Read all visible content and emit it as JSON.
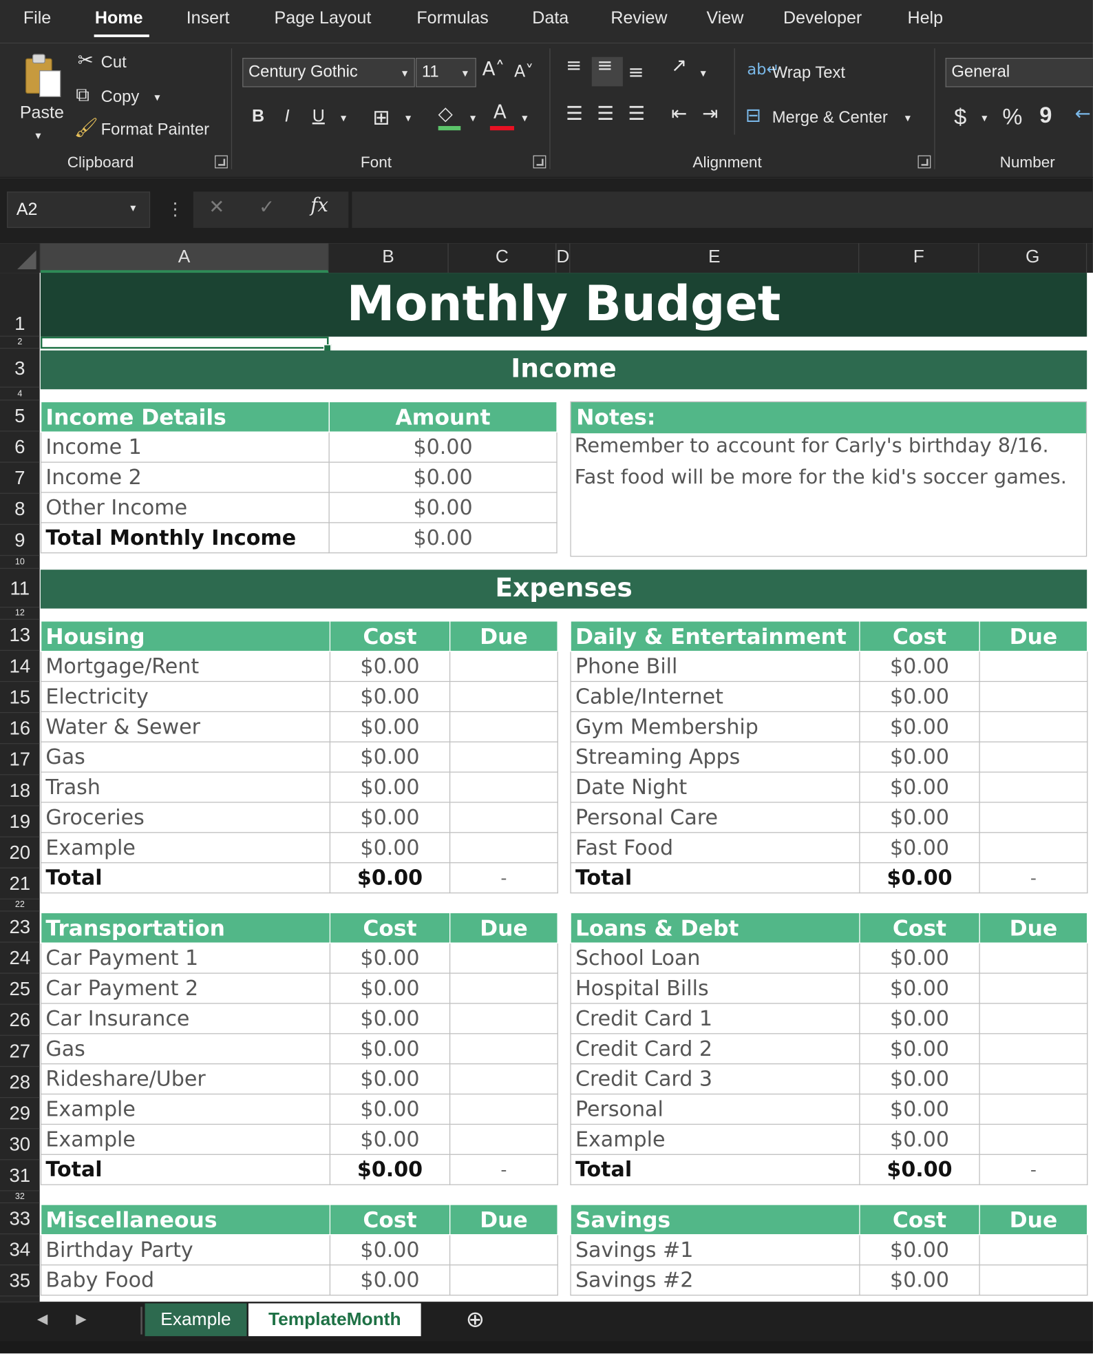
{
  "menu": [
    "File",
    "Home",
    "Insert",
    "Page Layout",
    "Formulas",
    "Data",
    "Review",
    "View",
    "Developer",
    "Help"
  ],
  "clipboard": {
    "paste": "Paste",
    "cut": "Cut",
    "copy": "Copy",
    "format_painter": "Format Painter",
    "label": "Clipboard"
  },
  "font": {
    "family": "Century Gothic",
    "size": "11",
    "label": "Font",
    "bold": "B",
    "italic": "I",
    "underline": "U"
  },
  "alignment": {
    "wrap": "Wrap Text",
    "merge": "Merge & Center",
    "label": "Alignment"
  },
  "number": {
    "format": "General",
    "label": "Number",
    "currency": "$",
    "percent": "%",
    "comma": "9"
  },
  "namebox": "A2",
  "columns": [
    "A",
    "B",
    "C",
    "D",
    "E",
    "F",
    "G"
  ],
  "rows": [
    "1",
    "2",
    "3",
    "4",
    "5",
    "6",
    "7",
    "8",
    "9",
    "10",
    "11",
    "12",
    "13",
    "14",
    "15",
    "16",
    "17",
    "18",
    "19",
    "20",
    "21",
    "22",
    "23",
    "24",
    "25",
    "26",
    "27",
    "28",
    "29",
    "30",
    "31",
    "32",
    "33",
    "34",
    "35"
  ],
  "sheet": {
    "title": "Monthly Budget",
    "income_band": "Income",
    "expenses_band": "Expenses",
    "income": {
      "headers": [
        "Income Details",
        "Amount"
      ],
      "rows": [
        [
          "Income 1",
          "$0.00"
        ],
        [
          "Income 2",
          "$0.00"
        ],
        [
          "Other Income",
          "$0.00"
        ]
      ],
      "total": [
        "Total Monthly Income",
        "$0.00"
      ]
    },
    "notes": {
      "header": "Notes:",
      "lines": [
        "Remember to account for Carly's birthday 8/16.",
        "Fast food will be more for the kid's soccer games."
      ]
    },
    "housing": {
      "headers": [
        "Housing",
        "Cost",
        "Due"
      ],
      "rows": [
        [
          "Mortgage/Rent",
          "$0.00"
        ],
        [
          "Electricity",
          "$0.00"
        ],
        [
          "Water & Sewer",
          "$0.00"
        ],
        [
          "Gas",
          "$0.00"
        ],
        [
          "Trash",
          "$0.00"
        ],
        [
          "Groceries",
          "$0.00"
        ],
        [
          "Example",
          "$0.00"
        ]
      ],
      "total": [
        "Total",
        "$0.00",
        "-"
      ]
    },
    "daily": {
      "headers": [
        "Daily & Entertainment",
        "Cost",
        "Due"
      ],
      "rows": [
        [
          "Phone Bill",
          "$0.00"
        ],
        [
          "Cable/Internet",
          "$0.00"
        ],
        [
          "Gym Membership",
          "$0.00"
        ],
        [
          "Streaming Apps",
          "$0.00"
        ],
        [
          "Date Night",
          "$0.00"
        ],
        [
          "Personal Care",
          "$0.00"
        ],
        [
          "Fast Food",
          "$0.00"
        ]
      ],
      "total": [
        "Total",
        "$0.00",
        "-"
      ]
    },
    "transportation": {
      "headers": [
        "Transportation",
        "Cost",
        "Due"
      ],
      "rows": [
        [
          "Car Payment 1",
          "$0.00"
        ],
        [
          "Car Payment 2",
          "$0.00"
        ],
        [
          "Car Insurance",
          "$0.00"
        ],
        [
          "Gas",
          "$0.00"
        ],
        [
          "Rideshare/Uber",
          "$0.00"
        ],
        [
          "Example",
          "$0.00"
        ],
        [
          "Example",
          "$0.00"
        ]
      ],
      "total": [
        "Total",
        "$0.00",
        "-"
      ]
    },
    "loans": {
      "headers": [
        "Loans & Debt",
        "Cost",
        "Due"
      ],
      "rows": [
        [
          "School Loan",
          "$0.00"
        ],
        [
          "Hospital Bills",
          "$0.00"
        ],
        [
          "Credit Card 1",
          "$0.00"
        ],
        [
          "Credit Card 2",
          "$0.00"
        ],
        [
          "Credit Card 3",
          "$0.00"
        ],
        [
          "Personal",
          "$0.00"
        ],
        [
          "Example",
          "$0.00"
        ]
      ],
      "total": [
        "Total",
        "$0.00",
        "-"
      ]
    },
    "misc": {
      "headers": [
        "Miscellaneous",
        "Cost",
        "Due"
      ],
      "rows": [
        [
          "Birthday Party",
          "$0.00"
        ],
        [
          "Baby Food",
          "$0.00"
        ]
      ]
    },
    "savings": {
      "headers": [
        "Savings",
        "Cost",
        "Due"
      ],
      "rows": [
        [
          "Savings #1",
          "$0.00"
        ],
        [
          "Savings #2",
          "$0.00"
        ]
      ]
    }
  },
  "tabs": [
    "Example",
    "TemplateMonth"
  ],
  "colors": {
    "title_band": "#1b4332",
    "section_band": "#2d6a4f",
    "table_header": "#52b788",
    "ribbon": "#2b2b2b"
  }
}
